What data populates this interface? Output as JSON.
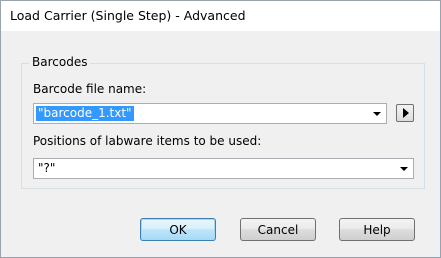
{
  "window": {
    "title": "Load Carrier (Single Step) - Advanced"
  },
  "barcodes_group": {
    "title": "Barcodes",
    "file_name_label": "Barcode file name:",
    "file_name_value": "\"barcode_1.txt\"",
    "positions_label": "Positions of labware items to be used:",
    "positions_value": "\"?\""
  },
  "buttons": {
    "ok": "OK",
    "cancel": "Cancel",
    "help": "Help"
  },
  "icons": {
    "dropdown": "chevron-down-icon",
    "expand": "play-right-icon"
  }
}
